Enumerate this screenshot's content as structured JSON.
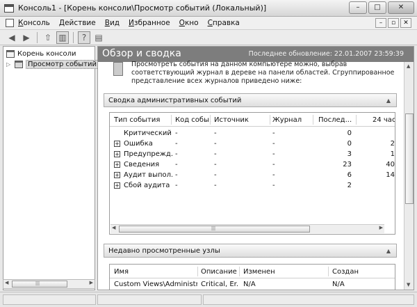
{
  "window": {
    "title": "Консоль1 - [Корень консоли\\Просмотр событий (Локальный)]",
    "buttons": {
      "minimize": "–",
      "maximize": "□",
      "close": "✕"
    }
  },
  "menubar": {
    "items": [
      {
        "label": "Консоль",
        "mnemonic": "К",
        "rest": "онсоль"
      },
      {
        "label": "Действие",
        "mnemonic": "Д",
        "rest": "ействие"
      },
      {
        "label": "Вид",
        "mnemonic": "В",
        "rest": "ид"
      },
      {
        "label": "Избранное",
        "mnemonic": "И",
        "rest": "збранное"
      },
      {
        "label": "Окно",
        "mnemonic": "О",
        "rest": "кно"
      },
      {
        "label": "Справка",
        "mnemonic": "С",
        "rest": "правка"
      }
    ],
    "mdi_buttons": {
      "minimize": "–",
      "restore": "▫",
      "close": "✕"
    }
  },
  "toolbar": {
    "icons": [
      "back-arrow-icon",
      "forward-arrow-icon",
      "up-folder-icon",
      "show-hide-tree-icon",
      "help-icon",
      "action-pane-icon"
    ],
    "glyphs": {
      "back": "◀",
      "forward": "▶",
      "up": "⇧",
      "tree": "▥",
      "help": "?",
      "pane": "▤"
    }
  },
  "tree": {
    "root_label": "Корень консоли",
    "child_label": "Просмотр событий",
    "child_expander": "▷"
  },
  "content": {
    "header_title": "Обзор и сводка",
    "last_update": "Последнее обновление: 22.01.2007 23:59:39",
    "intro_text": "Просмотреть события на данном компьютере можно, выбрав соответствующий журнал в дереве на панели областей. Сгруппированное представление всех журналов приведено ниже:",
    "summary_section": {
      "title": "Сводка административных событий",
      "columns": [
        "Тип события",
        "Код собы...",
        "Источник",
        "Журнал",
        "Послед...",
        "24 час"
      ],
      "rows": [
        {
          "type": "Критический",
          "expandable": false,
          "code": "-",
          "source": "-",
          "log": "-",
          "last": "0",
          "h24": ""
        },
        {
          "type": "Ошибка",
          "expandable": true,
          "code": "-",
          "source": "-",
          "log": "-",
          "last": "0",
          "h24": "2"
        },
        {
          "type": "Предупрежд...",
          "expandable": true,
          "code": "-",
          "source": "-",
          "log": "-",
          "last": "3",
          "h24": "1"
        },
        {
          "type": "Сведения",
          "expandable": true,
          "code": "-",
          "source": "-",
          "log": "-",
          "last": "23",
          "h24": "40"
        },
        {
          "type": "Аудит выпол...",
          "expandable": true,
          "code": "-",
          "source": "-",
          "log": "-",
          "last": "6",
          "h24": "14"
        },
        {
          "type": "Сбой аудита",
          "expandable": true,
          "code": "-",
          "source": "-",
          "log": "-",
          "last": "2",
          "h24": ""
        }
      ]
    },
    "recent_section": {
      "title": "Недавно просмотренные узлы",
      "columns": [
        "Имя",
        "Описание",
        "Изменен",
        "Создан"
      ],
      "rows": [
        {
          "name": "Custom Views\\Administr...",
          "description": "Critical, Er...",
          "modified": "N/A",
          "created": "N/A"
        }
      ]
    },
    "caret": "▲"
  },
  "scroll": {
    "left_arrow": "◀",
    "right_arrow": "▶",
    "up_arrow": "▲",
    "down_arrow": "▼",
    "grip": "|||"
  }
}
